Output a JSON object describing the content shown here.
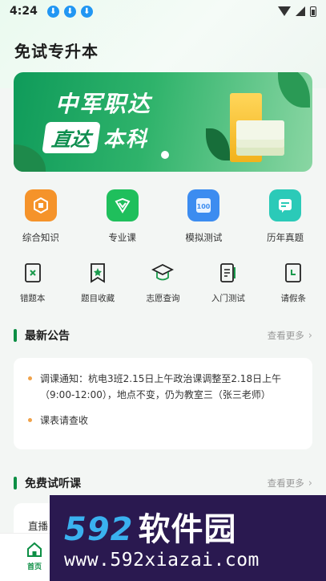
{
  "status_bar": {
    "time": "4:24"
  },
  "app": {
    "title": "免试专升本"
  },
  "banner": {
    "line1": "中军职达",
    "line2a": "直达",
    "line2b": "本科"
  },
  "main_features": [
    {
      "label": "综合知识",
      "icon": "comprehensive-knowledge-icon",
      "color": "#f5932a"
    },
    {
      "label": "专业课",
      "icon": "major-course-icon",
      "color": "#1fbf5c"
    },
    {
      "label": "模拟测试",
      "icon": "mock-test-icon",
      "color": "#3c8cf0"
    },
    {
      "label": "历年真题",
      "icon": "past-exam-icon",
      "color": "#2bcab8"
    }
  ],
  "tools": [
    {
      "label": "错题本",
      "icon": "mistake-book-icon"
    },
    {
      "label": "题目收藏",
      "icon": "bookmark-icon"
    },
    {
      "label": "志愿查询",
      "icon": "graduation-cap-icon"
    },
    {
      "label": "入门测试",
      "icon": "entry-test-icon"
    },
    {
      "label": "请假条",
      "icon": "leave-note-icon"
    }
  ],
  "announcements": {
    "title": "最新公告",
    "more": "查看更多",
    "items": [
      {
        "line1": "调课通知：杭电3班2.15日上午政治课调整至2.18日上午",
        "line2": "（9:00-12:00），地点不变，仍为教室三（张三老师）"
      },
      {
        "line1": "课表请查收",
        "line2": ""
      }
    ]
  },
  "free_trial": {
    "title": "免费试听课",
    "more": "查看更多",
    "first_item": "直播"
  },
  "tabbar": {
    "home": "首页"
  },
  "watermark": {
    "brand_num": "592",
    "brand_cn": "软件园",
    "url": "www.592xiazai.com"
  }
}
